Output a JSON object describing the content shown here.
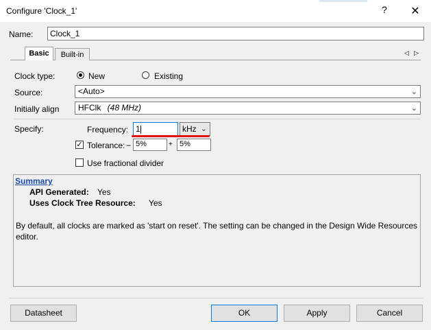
{
  "window": {
    "title": "Configure 'Clock_1'",
    "help_glyph": "?",
    "close_glyph": "✕"
  },
  "name_field": {
    "label": "Name:",
    "value": "Clock_1"
  },
  "tabs": [
    {
      "label": "Basic"
    },
    {
      "label": "Built-in"
    }
  ],
  "tab_scroll": {
    "left_glyph": "◁",
    "right_glyph": "▷"
  },
  "clock_type": {
    "label": "Clock type:",
    "options": [
      {
        "label": "New",
        "selected": true
      },
      {
        "label": "Existing",
        "selected": false
      }
    ]
  },
  "source": {
    "label": "Source:",
    "value": "<Auto>"
  },
  "initially_align": {
    "label": "Initially align",
    "value": "HFClk",
    "value_detail": "(48 MHz)"
  },
  "specify": {
    "label": "Specify:",
    "frequency_label": "Frequency:",
    "frequency_value": "1",
    "frequency_unit": "kHz",
    "tolerance_label": "Tolerance:",
    "tolerance_checked": true,
    "tolerance_minus_sign": "−",
    "tolerance_minus": "5%",
    "tolerance_plus_sign": "+",
    "tolerance_plus": "5%",
    "fractional_label": "Use fractional divider",
    "fractional_checked": false
  },
  "summary": {
    "heading": "Summary",
    "api_generated_label": "API Generated:",
    "api_generated_value": "Yes",
    "uses_tree_label": "Uses Clock Tree Resource:",
    "uses_tree_value": "Yes",
    "description": "By default, all clocks are marked as 'start on reset'. The setting can be changed in the Design Wide Resources editor."
  },
  "buttons": {
    "datasheet": "Datasheet",
    "ok": "OK",
    "apply": "Apply",
    "cancel": "Cancel"
  },
  "colors": {
    "highlight_underline": "#e01010",
    "link": "#1a4aa8",
    "default_button_border": "#0078d7"
  }
}
